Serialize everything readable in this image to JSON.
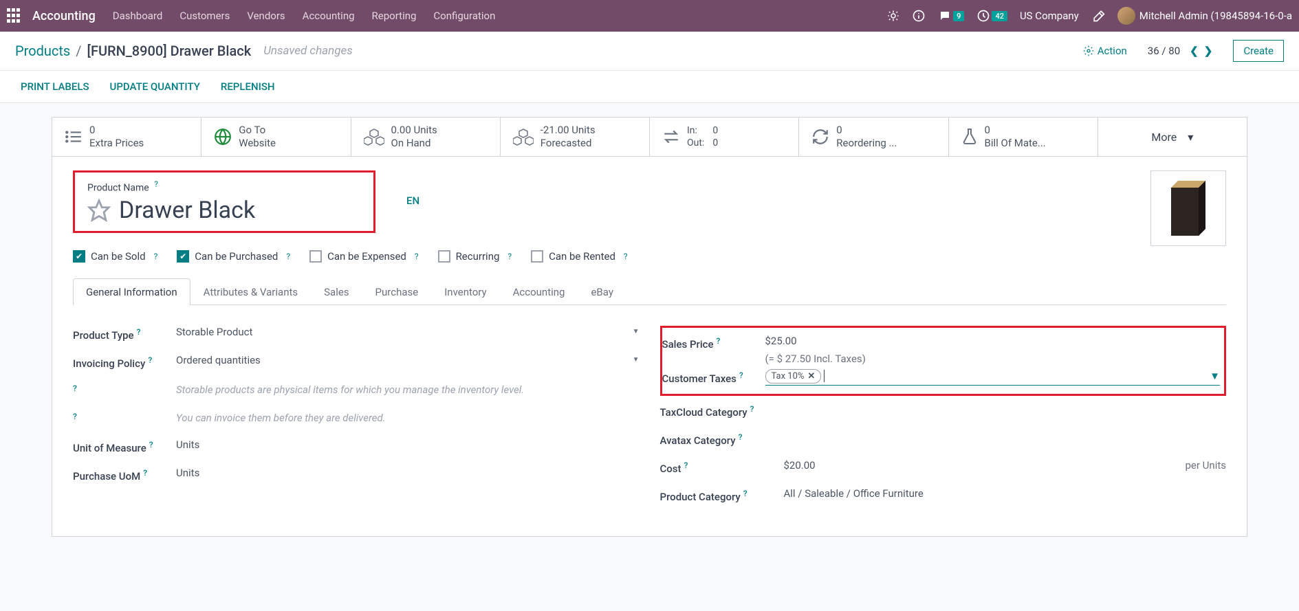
{
  "navbar": {
    "brand": "Accounting",
    "links": [
      "Dashboard",
      "Customers",
      "Vendors",
      "Accounting",
      "Reporting",
      "Configuration"
    ],
    "chat_badge": "9",
    "clock_badge": "42",
    "company": "US Company",
    "user": "Mitchell Admin (19845894-16-0-a"
  },
  "breadcrumb": {
    "root": "Products",
    "current": "[FURN_8900] Drawer Black",
    "status": "Unsaved changes",
    "action_label": "Action",
    "pager": "36 / 80",
    "create": "Create"
  },
  "actions": {
    "print": "PRINT LABELS",
    "update": "UPDATE QUANTITY",
    "replenish": "REPLENISH"
  },
  "stats": {
    "extra_prices": {
      "val": "0",
      "label": "Extra Prices"
    },
    "website": {
      "val": "Go To",
      "label": "Website"
    },
    "onhand": {
      "val": "0.00 Units",
      "label": "On Hand"
    },
    "forecasted": {
      "val": "-21.00 Units",
      "label": "Forecasted"
    },
    "inout": {
      "in_label": "In:",
      "in_val": "0",
      "out_label": "Out:",
      "out_val": "0"
    },
    "reordering": {
      "val": "0",
      "label": "Reordering ..."
    },
    "bom": {
      "val": "0",
      "label": "Bill Of Mate..."
    },
    "more": "More"
  },
  "form": {
    "name_label": "Product Name",
    "name_value": "Drawer Black",
    "lang": "EN",
    "checks": {
      "sold": "Can be Sold",
      "purchased": "Can be Purchased",
      "expensed": "Can be Expensed",
      "recurring": "Recurring",
      "rented": "Can be Rented"
    },
    "tabs": [
      "General Information",
      "Attributes & Variants",
      "Sales",
      "Purchase",
      "Inventory",
      "Accounting",
      "eBay"
    ]
  },
  "left": {
    "product_type_label": "Product Type",
    "product_type_value": "Storable Product",
    "invoicing_label": "Invoicing Policy",
    "invoicing_value": "Ordered quantities",
    "note1": "Storable products are physical items for which you manage the inventory level.",
    "note2": "You can invoice them before they are delivered.",
    "uom_label": "Unit of Measure",
    "uom_value": "Units",
    "puom_label": "Purchase UoM",
    "puom_value": "Units"
  },
  "right": {
    "sales_price_label": "Sales Price",
    "sales_price_value": "$25.00",
    "sales_price_incl": "(= $ 27.50 Incl. Taxes)",
    "customer_taxes_label": "Customer Taxes",
    "customer_taxes_tag": "Tax 10%",
    "taxcloud_label": "TaxCloud Category",
    "avatax_label": "Avatax Category",
    "cost_label": "Cost",
    "cost_value": "$20.00",
    "cost_per": "per Units",
    "category_label": "Product Category",
    "category_value": "All / Saleable / Office Furniture"
  },
  "help": "?"
}
